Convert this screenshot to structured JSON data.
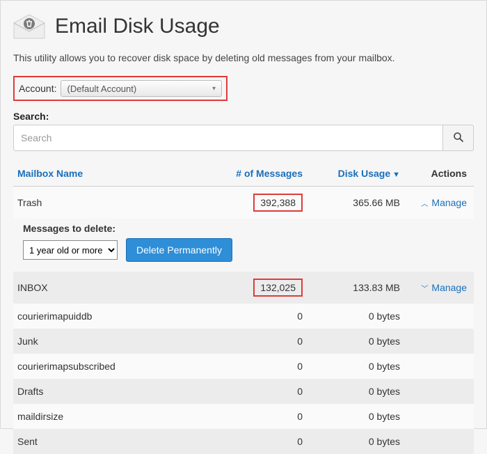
{
  "header": {
    "title": "Email Disk Usage"
  },
  "intro": "This utility allows you to recover disk space by deleting old messages from your mailbox.",
  "account": {
    "label": "Account:",
    "selected": "(Default Account)"
  },
  "search": {
    "label": "Search:",
    "placeholder": "Search"
  },
  "columns": {
    "name": "Mailbox Name",
    "messages": "# of Messages",
    "disk": "Disk Usage",
    "sort_indicator": "▼",
    "actions": "Actions"
  },
  "manage_label": "Manage",
  "expanded": {
    "label": "Messages to delete:",
    "select_value": "1 year old or more",
    "button": "Delete Permanently"
  },
  "rows": [
    {
      "name": "Trash",
      "messages": "392,388",
      "disk": "365.66 MB",
      "highlight_messages": true,
      "expanded": true
    },
    {
      "name": "INBOX",
      "messages": "132,025",
      "disk": "133.83 MB",
      "highlight_messages": true,
      "expanded": false
    },
    {
      "name": "courierimapuiddb",
      "messages": "0",
      "disk": "0 bytes",
      "highlight_messages": false
    },
    {
      "name": "Junk",
      "messages": "0",
      "disk": "0 bytes",
      "highlight_messages": false
    },
    {
      "name": "courierimapsubscribed",
      "messages": "0",
      "disk": "0 bytes",
      "highlight_messages": false
    },
    {
      "name": "Drafts",
      "messages": "0",
      "disk": "0 bytes",
      "highlight_messages": false
    },
    {
      "name": "maildirsize",
      "messages": "0",
      "disk": "0 bytes",
      "highlight_messages": false
    },
    {
      "name": "Sent",
      "messages": "0",
      "disk": "0 bytes",
      "highlight_messages": false
    }
  ]
}
